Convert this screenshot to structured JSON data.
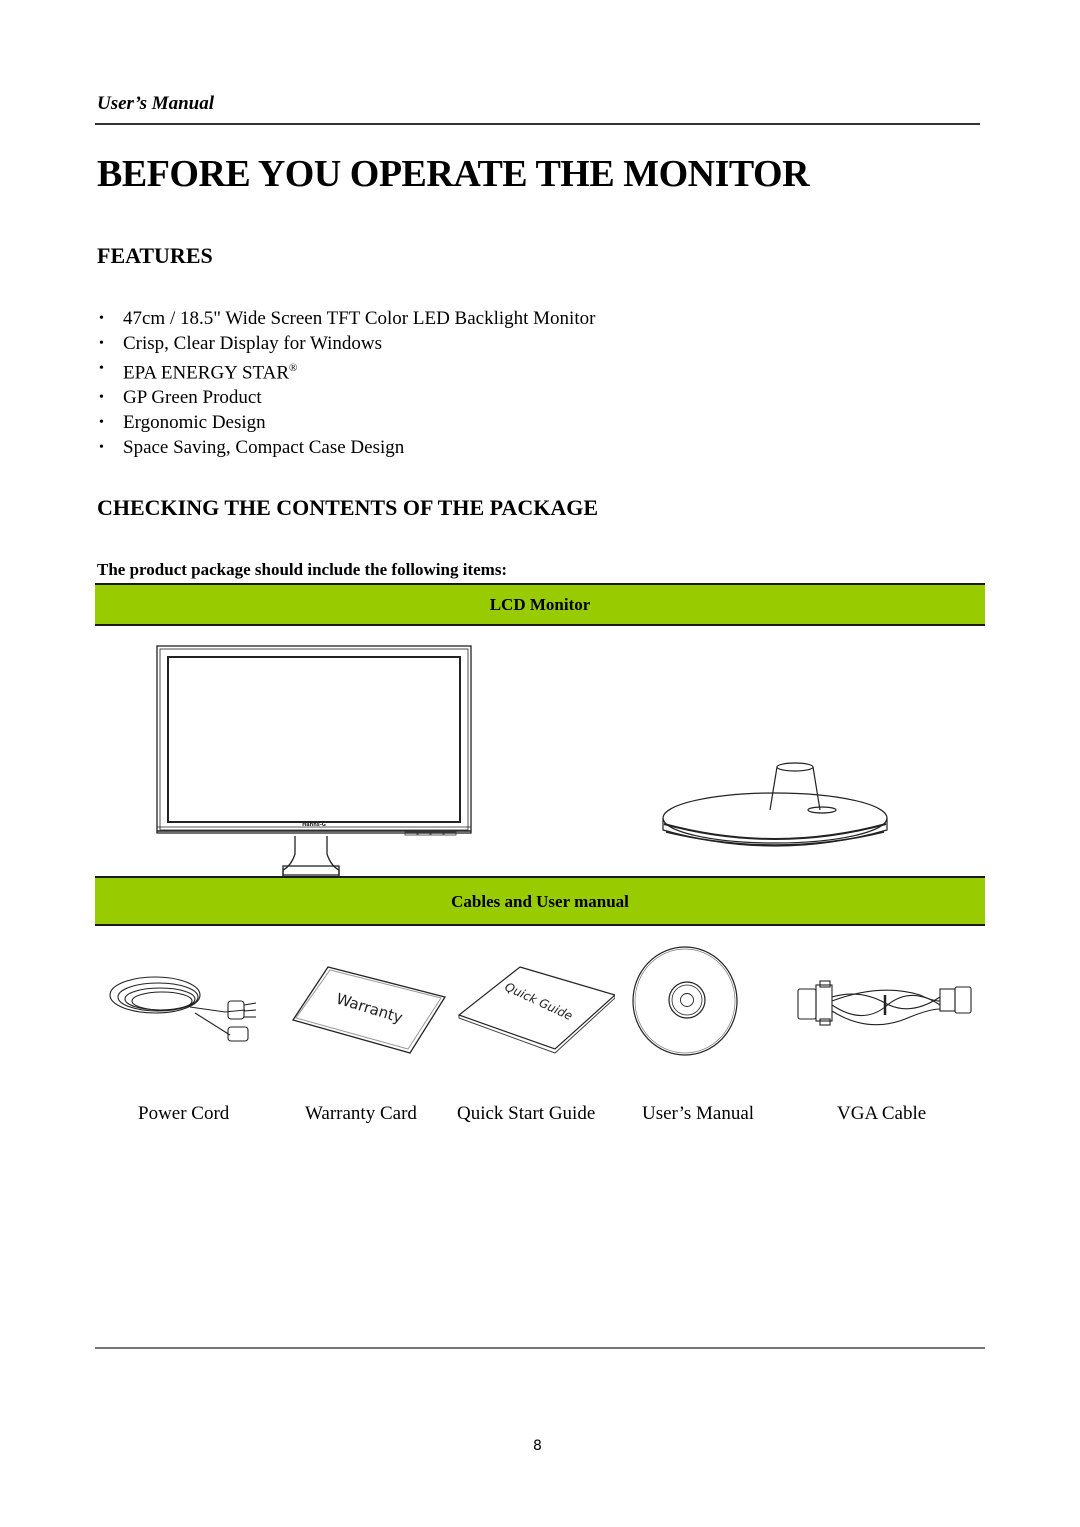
{
  "header": {
    "label": "User’s Manual"
  },
  "page_title": "BEFORE YOU OPERATE THE MONITOR",
  "features": {
    "title": "FEATURES",
    "items": [
      {
        "text": "47cm / 18.5\" Wide Screen TFT Color LED Backlight Monitor",
        "sup": ""
      },
      {
        "text": "Crisp, Clear Display for Windows",
        "sup": ""
      },
      {
        "text": "EPA ENERGY STAR",
        "sup": "®"
      },
      {
        "text": "GP Green Product",
        "sup": ""
      },
      {
        "text": "Ergonomic Design",
        "sup": ""
      },
      {
        "text": "Space Saving, Compact Case Design",
        "sup": ""
      }
    ],
    "bullet": "•"
  },
  "package": {
    "title": "CHECKING THE CONTENTS OF THE PACKAGE",
    "intro": "The product package should include the following items:",
    "band_color": "#99cc00",
    "sections": [
      {
        "heading": "LCD Monitor",
        "images": [
          "monitor-illustration",
          "stand-base-illustration"
        ]
      },
      {
        "heading": "Cables and User manual",
        "images": [
          "power-cord-illustration",
          "warranty-card-illustration",
          "quick-guide-illustration",
          "cd-illustration",
          "vga-cable-illustration"
        ]
      }
    ],
    "monitor_brand_mark": "Hanns-G",
    "warranty_text": "Warranty",
    "quick_guide_text": "Quick Guide",
    "item_labels": [
      "Power Cord",
      "Warranty Card",
      "Quick Start Guide",
      "User’s Manual",
      "VGA Cable"
    ]
  },
  "footer": {
    "page_number": "8"
  }
}
